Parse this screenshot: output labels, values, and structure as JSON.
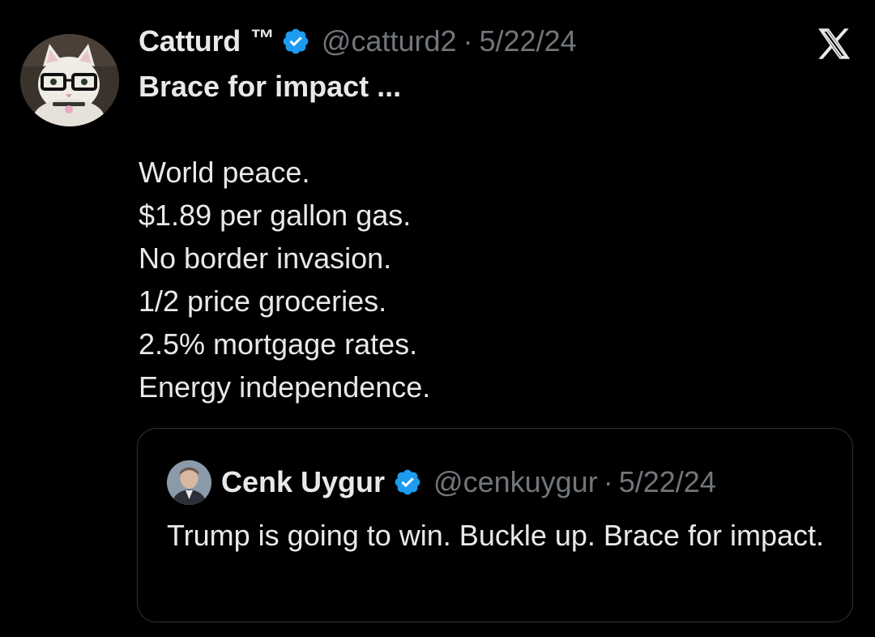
{
  "tweet": {
    "author": {
      "display_name": "Catturd",
      "trademark": "™",
      "handle": "@catturd2",
      "avatar_icon": "cat-with-glasses-avatar",
      "verified_icon": "verified-badge-icon"
    },
    "separator": "·",
    "date": "5/22/24",
    "text": {
      "first_line": "Brace for impact ...",
      "lines": [
        "World peace.",
        "$1.89 per gallon gas.",
        "No border invasion.",
        "1/2 price groceries.",
        "2.5% mortgage rates.",
        "Energy independence."
      ]
    },
    "platform_icon": "x-logo-icon"
  },
  "quoted_tweet": {
    "author": {
      "display_name": "Cenk Uygur",
      "handle": "@cenkuygur",
      "avatar_icon": "cenk-uygur-avatar",
      "verified_icon": "verified-badge-icon"
    },
    "separator": "·",
    "date": "5/22/24",
    "text": "Trump is going to win. Buckle up. Brace for impact."
  },
  "colors": {
    "background": "#000000",
    "primary_text": "#e7e9ea",
    "secondary_text": "#71767b",
    "verified_blue": "#1d9bf0",
    "border": "#2f3336"
  }
}
